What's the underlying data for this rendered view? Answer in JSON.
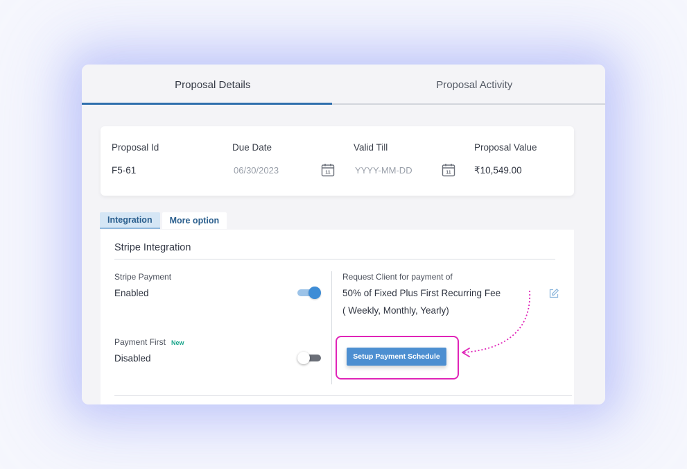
{
  "tabs": {
    "details": "Proposal Details",
    "activity": "Proposal Activity"
  },
  "info": {
    "proposal_id": {
      "label": "Proposal Id",
      "value": "F5-61"
    },
    "due_date": {
      "label": "Due Date",
      "value": "06/30/2023"
    },
    "valid_till": {
      "label": "Valid Till",
      "placeholder": "YYYY-MM-DD"
    },
    "proposal_value": {
      "label": "Proposal Value",
      "value": "₹10,549.00"
    },
    "calendar_day": "11"
  },
  "subtabs": {
    "integration": "Integration",
    "more_option": "More option"
  },
  "integration": {
    "title": "Stripe Integration",
    "stripe_payment": {
      "label": "Stripe Payment",
      "value": "Enabled",
      "enabled": true
    },
    "payment_first": {
      "label": "Payment First",
      "badge": "New",
      "value": "Disabled",
      "enabled": false
    },
    "request_label": "Request Client for payment of",
    "request_line1": "50% of Fixed Plus First Recurring Fee",
    "request_line2": "( Weekly, Monthly, Yearly)",
    "setup_button": "Setup Payment Schedule"
  },
  "colors": {
    "accent": "#2f6fad",
    "button": "#4d8fd1",
    "highlight": "#e024b8",
    "badge": "#1aa58b"
  },
  "icons": [
    "calendar-icon",
    "edit-icon",
    "dotted-arrow-icon"
  ]
}
